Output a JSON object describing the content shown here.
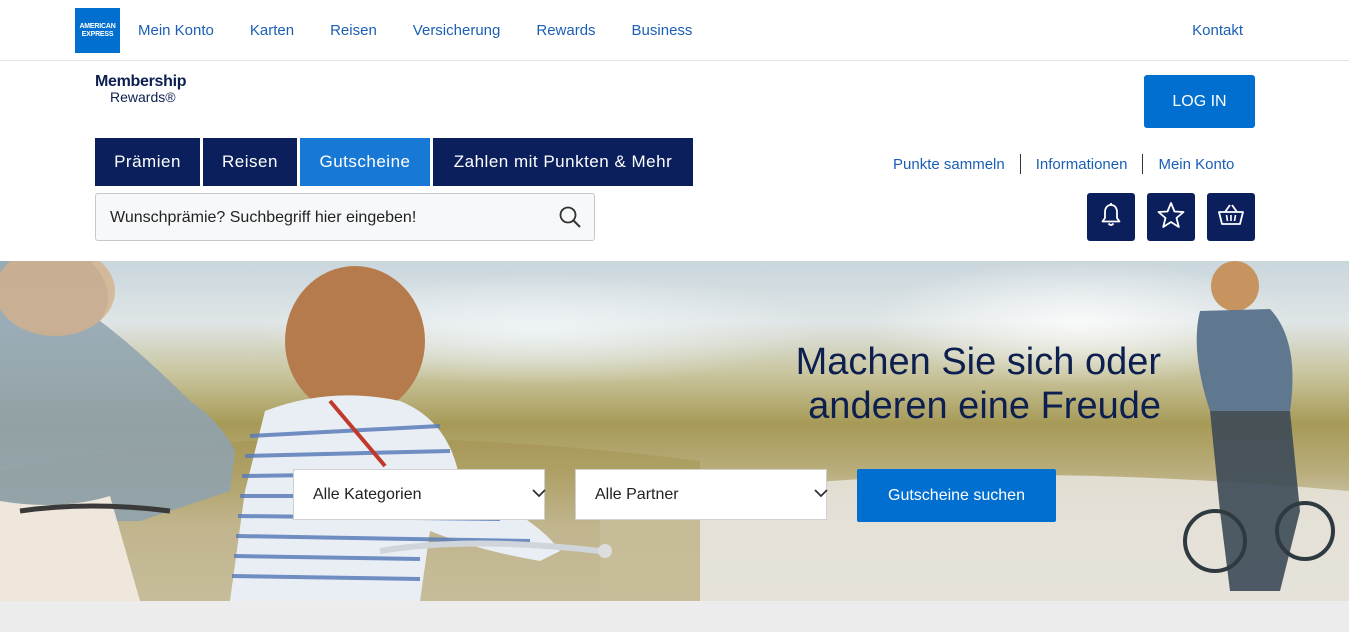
{
  "topbar": {
    "logo_line1": "AMERICAN",
    "logo_line2": "EXPRESS",
    "nav": [
      "Mein Konto",
      "Karten",
      "Reisen",
      "Versicherung",
      "Rewards",
      "Business"
    ],
    "contact": "Kontakt"
  },
  "header": {
    "logo_line1": "Membership",
    "logo_line2": "Rewards®",
    "login": "LOG IN",
    "tabs": [
      "Prämien",
      "Reisen",
      "Gutscheine",
      "Zahlen mit Punkten & Mehr"
    ],
    "active_tab": "Gutscheine",
    "links": [
      "Punkte sammeln",
      "Informationen",
      "Mein Konto"
    ],
    "search_placeholder": "Wunschprämie? Suchbegriff hier eingeben!",
    "icons": [
      "bell-icon",
      "star-icon",
      "basket-icon"
    ]
  },
  "hero": {
    "title_line1": "Machen Sie sich oder",
    "title_line2": "anderen eine Freude",
    "category_select": "Alle Kategorien",
    "partner_select": "Alle Partner",
    "search_button": "Gutscheine suchen"
  },
  "colors": {
    "brand_blue": "#016fd0",
    "navy": "#0a1f5c",
    "active_tab": "#1878d6",
    "link": "#1a5fb4"
  }
}
